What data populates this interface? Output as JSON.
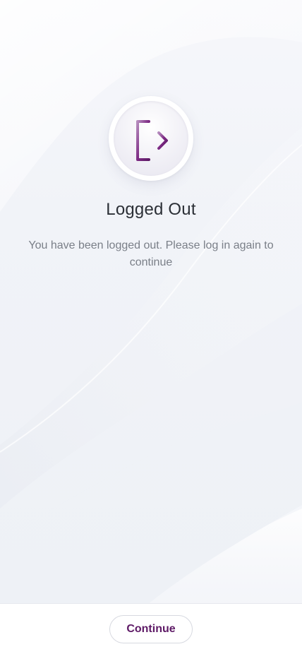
{
  "logout_screen": {
    "icon": "logout-icon",
    "title": "Logged Out",
    "message": "You have been logged out. Please log in again to continue"
  },
  "footer": {
    "continue_label": "Continue"
  },
  "colors": {
    "accent": "#5e1a66",
    "icon_stroke": "#6b1f72",
    "title_text": "#2b2f36",
    "body_text": "#7a7f88",
    "background": "#f3f5f9"
  }
}
